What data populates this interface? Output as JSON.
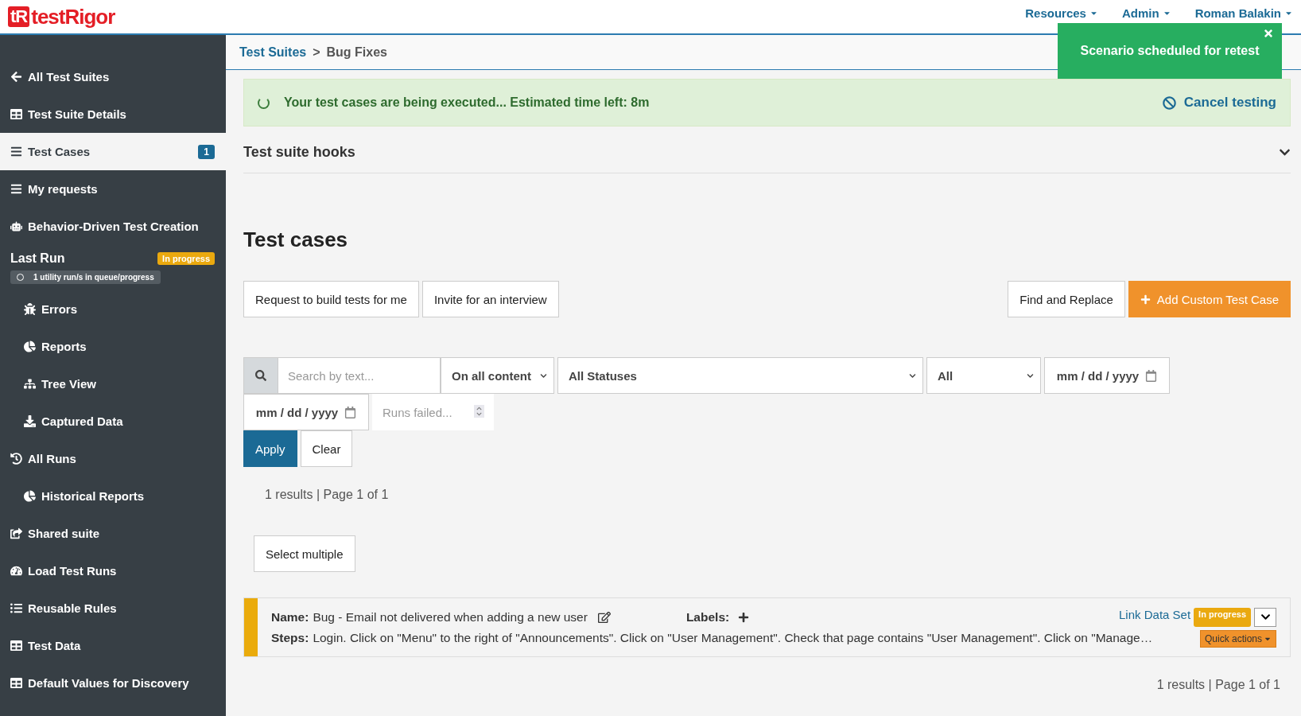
{
  "header": {
    "logo_mark": "tR",
    "logo_text": "testRigor",
    "nav": [
      {
        "label": "Resources"
      },
      {
        "label": "Admin"
      },
      {
        "label": "Roman Balakin"
      }
    ]
  },
  "toast": {
    "message": "Scenario scheduled for retest"
  },
  "breadcrumb": {
    "items": [
      "Test Suites",
      "Bug Fixes"
    ],
    "separator": ">"
  },
  "sidebar": {
    "items": [
      {
        "kind": "link",
        "label": "All Test Suites",
        "indented": false,
        "selected": false
      },
      {
        "kind": "link",
        "label": "Test Suite Details",
        "indented": false,
        "selected": false
      },
      {
        "kind": "link",
        "label": "Test Cases",
        "indented": false,
        "selected": true,
        "badge": "1"
      },
      {
        "kind": "link",
        "label": "My requests",
        "indented": false,
        "selected": false
      },
      {
        "kind": "link",
        "label": "Behavior-Driven Test Creation",
        "indented": false,
        "selected": false
      },
      {
        "kind": "status",
        "label": "Last Run",
        "badge": "In progress",
        "note": "1 utility run/s in queue/progress"
      },
      {
        "kind": "link",
        "label": "Errors",
        "indented": true,
        "selected": false
      },
      {
        "kind": "link",
        "label": "Reports",
        "indented": true,
        "selected": false
      },
      {
        "kind": "link",
        "label": "Tree View",
        "indented": true,
        "selected": false
      },
      {
        "kind": "link",
        "label": "Captured Data",
        "indented": true,
        "selected": false
      },
      {
        "kind": "link",
        "label": "All Runs",
        "indented": false,
        "selected": false
      },
      {
        "kind": "link",
        "label": "Historical Reports",
        "indented": true,
        "selected": false
      },
      {
        "kind": "link",
        "label": "Shared suite",
        "indented": false,
        "selected": false
      },
      {
        "kind": "link",
        "label": "Load Test Runs",
        "indented": false,
        "selected": false
      },
      {
        "kind": "link",
        "label": "Reusable Rules",
        "indented": false,
        "selected": false
      },
      {
        "kind": "link",
        "label": "Test Data",
        "indented": false,
        "selected": false
      },
      {
        "kind": "link",
        "label": "Default Values for Discovery",
        "indented": false,
        "selected": false
      }
    ]
  },
  "banner": {
    "message": "Your test cases are being executed... Estimated time left: 8m",
    "action": "Cancel testing"
  },
  "hooks": {
    "title": "Test suite hooks",
    "expanded": false
  },
  "heading": "Test cases",
  "actions_left": [
    "Request to build tests for me",
    "Invite for an interview"
  ],
  "actions_right": [
    {
      "label": "Find and Replace",
      "kind": "plain"
    },
    {
      "label": "Add Custom Test Case",
      "kind": "primary"
    }
  ],
  "filters": {
    "search_placeholder": "Search by text...",
    "scope": "On all content",
    "status": "All Statuses",
    "type": "All",
    "date_from": "mm / dd / yyyy",
    "date_to": "mm / dd / yyyy",
    "runs_failed_placeholder": "Runs failed...",
    "apply": "Apply",
    "clear": "Clear"
  },
  "results_top": "1 results | Page 1 of 1",
  "select_multiple": "Select multiple",
  "test_cases": [
    {
      "name_label": "Name:",
      "name": "Bug - Email not delivered when adding a new user",
      "labels_label": "Labels:",
      "steps_label": "Steps:",
      "steps": "Login. Click on \"Menu\" to the right of \"Announcements\". Click on \"User Management\". Check that page contains \"User Management\". Click on \"Manage…",
      "link": "Link Data Set",
      "status": "In progress",
      "quick_actions": "Quick actions",
      "expanded": false
    }
  ],
  "results_bottom": "1 results | Page 1 of 1"
}
